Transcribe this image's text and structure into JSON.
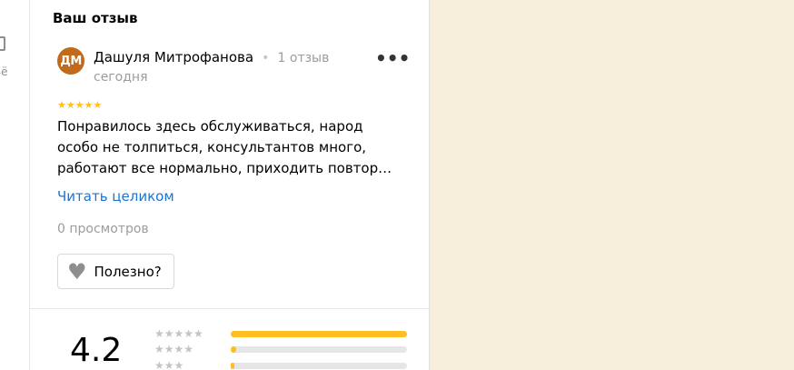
{
  "left_rail": {
    "label": "ьё"
  },
  "review_section": {
    "title": "Ваш отзыв",
    "review": {
      "avatar_initials": "ДМ",
      "author": "Дашуля Митрофанова",
      "separator": "•",
      "reviews_count": "1 отзыв",
      "date": "сегодня",
      "more_label": "•••",
      "stars": "★★★★★",
      "rating": 5,
      "text_lines": [
        "Понравилось здесь обслуживаться, народ",
        "особо не толпиться, консультантов много,",
        "работают все нормально, приходить повтор…"
      ],
      "read_more": "Читать целиком",
      "views": "0 просмотров",
      "useful_label": "Полезно?"
    }
  },
  "rating_summary": {
    "value": "4.2",
    "distribution": [
      {
        "stars": "★★★★★",
        "fraction": 1.0
      },
      {
        "stars": "★★★★",
        "fraction": 0.03
      },
      {
        "stars": "★★★",
        "fraction": 0.02
      }
    ]
  },
  "colors": {
    "accent_link": "#1a75d2",
    "star": "#ffbe22",
    "avatar_bg": "#c26a1b",
    "map_bg": "#f7eedb"
  }
}
